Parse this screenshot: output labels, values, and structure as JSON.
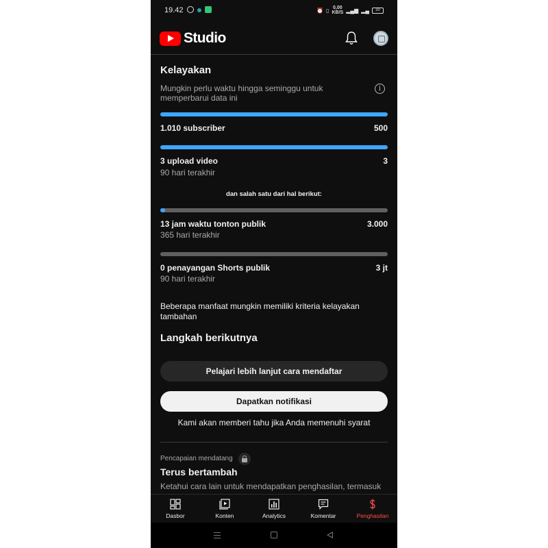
{
  "status_bar": {
    "time": "19.42",
    "speed_top": "0,00",
    "speed_bottom": "KB/S",
    "battery": "30"
  },
  "header": {
    "logo_text": "Studio"
  },
  "eligibility": {
    "title": "Kelayakan",
    "note": "Mungkin perlu waktu hingga seminggu untuk memperbarui data ini",
    "subscribers": {
      "label": "1.010 subscriber",
      "target": "500",
      "progress": 1.0
    },
    "uploads": {
      "label": "3 upload video",
      "target": "3",
      "period": "90 hari terakhir",
      "progress": 1.0
    },
    "or_text": "dan salah satu dari hal berikut:",
    "watch_hours": {
      "label": "13 jam waktu tonton publik",
      "target": "3.000",
      "period": "365 hari terakhir",
      "progress": 0.0043
    },
    "shorts_views": {
      "label": "0 penayangan Shorts publik",
      "target": "3 jt",
      "period": "90 hari terakhir",
      "progress": 0
    },
    "extra_note": "Beberapa manfaat mungkin memiliki kriteria kelayakan tambahan"
  },
  "next_steps": {
    "title": "Langkah berikutnya",
    "learn_button": "Pelajari lebih lanjut cara mendaftar",
    "notify_button": "Dapatkan notifikasi",
    "notify_note": "Kami akan memberi tahu jika Anda memenuhi syarat"
  },
  "upcoming": {
    "label": "Pencapaian mendatang",
    "title": "Terus bertambah",
    "description": "Ketahui cara lain untuk mendapatkan penghasilan, termasuk"
  },
  "bottom_nav": {
    "items": [
      {
        "label": "Dasbor",
        "icon": "dashboard-icon"
      },
      {
        "label": "Konten",
        "icon": "content-icon"
      },
      {
        "label": "Analytics",
        "icon": "analytics-icon"
      },
      {
        "label": "Komentar",
        "icon": "comments-icon"
      },
      {
        "label": "Penghasilan",
        "icon": "dollar-icon"
      }
    ],
    "active_color": "#ff4e45"
  },
  "colors": {
    "progress_fill": "#3ea6ff",
    "progress_track": "#606060",
    "brand_red": "#ff0000"
  }
}
